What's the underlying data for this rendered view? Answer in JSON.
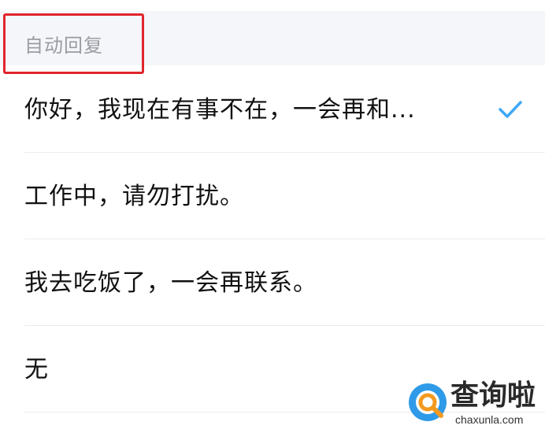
{
  "section": {
    "title": "自动回复"
  },
  "options": [
    {
      "label": "你好，我现在有事不在，一会再和...",
      "selected": true
    },
    {
      "label": "工作中，请勿打扰。",
      "selected": false
    },
    {
      "label": "我去吃饭了，一会再联系。",
      "selected": false
    },
    {
      "label": "无",
      "selected": false
    }
  ],
  "colors": {
    "accent": "#3fa9f5",
    "highlight": "#e1252c",
    "header_bg": "#f5f6fa"
  },
  "watermark": {
    "name": "查询啦",
    "url": "chaxunla.com"
  }
}
